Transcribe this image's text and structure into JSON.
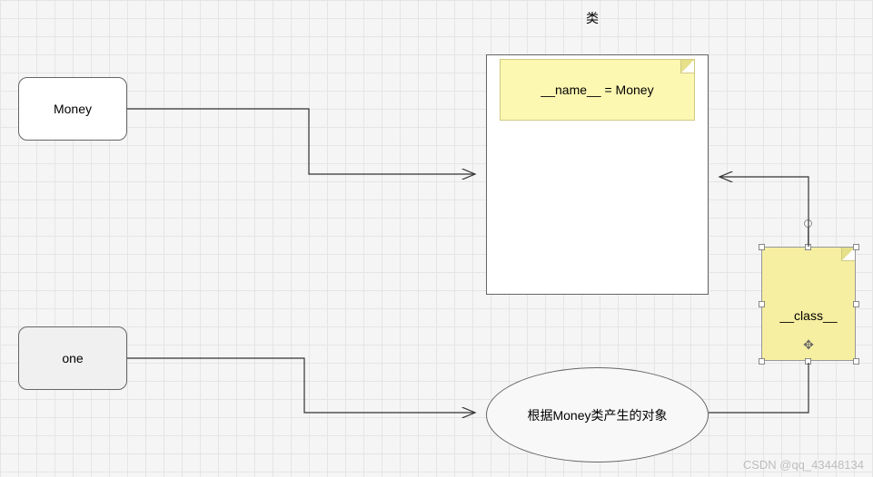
{
  "label_top": "类",
  "money_box": "Money",
  "one_box": "one",
  "sticky_name": "__name__ = Money",
  "sticky_class": "__class__",
  "ellipse_text": "根据Money类产生的对象",
  "watermark": "CSDN @qq_43448134"
}
